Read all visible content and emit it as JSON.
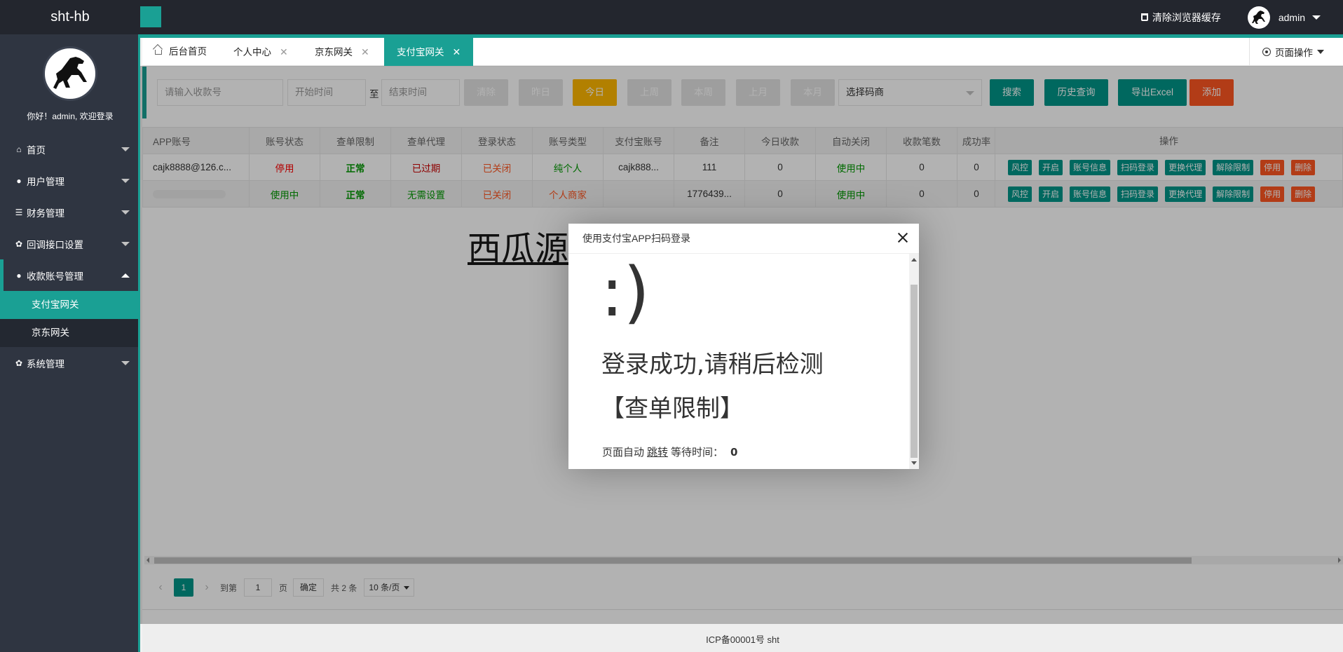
{
  "app": {
    "title": "sht-hb"
  },
  "header": {
    "clear_cache": "清除浏览器缓存",
    "user_name": "admin"
  },
  "sidebar": {
    "welcome": "你好！admin, 欢迎登录",
    "menu": [
      {
        "label": "首页",
        "icon": "home-icon"
      },
      {
        "label": "用户管理",
        "icon": "user-icon"
      },
      {
        "label": "财务管理",
        "icon": "list-icon"
      },
      {
        "label": "回调接口设置",
        "icon": "gear-icon"
      },
      {
        "label": "收款账号管理",
        "icon": "users-icon",
        "expanded": true,
        "children": [
          {
            "label": "支付宝网关",
            "active": true
          },
          {
            "label": "京东网关"
          }
        ]
      },
      {
        "label": "系统管理",
        "icon": "gear-icon"
      }
    ]
  },
  "tabs": {
    "items": [
      {
        "label": "后台首页"
      },
      {
        "label": "个人中心"
      },
      {
        "label": "京东网关"
      },
      {
        "label": "支付宝网关",
        "active": true
      }
    ],
    "close": "✕",
    "page_ops": "页面操作"
  },
  "search": {
    "account_placeholder": "请输入收款号",
    "start_placeholder": "开始时间",
    "to": "至",
    "end_placeholder": "结束时间",
    "clear": "清除",
    "yesterday": "昨日",
    "today": "今日",
    "last_week": "上周",
    "this_week": "本周",
    "last_month": "上月",
    "this_month": "本月",
    "merchant_select": "选择码商",
    "search": "搜索",
    "history": "历史查询",
    "export": "导出Excel",
    "add": "添加"
  },
  "table": {
    "columns": [
      "APP账号",
      "账号状态",
      "查单限制",
      "查单代理",
      "登录状态",
      "账号类型",
      "支付宝账号",
      "备注",
      "今日收款",
      "自动关闭",
      "收款笔数",
      "成功率"
    ],
    "ops_header": "操作",
    "rows": [
      [
        "cajk8888@126.c...",
        "停用",
        "正常",
        "已过期",
        "已关闭",
        "纯个人",
        "cajk888...",
        "111",
        "0",
        "使用中",
        "0",
        "0"
      ],
      [
        "",
        "使用中",
        "正常",
        "无需设置",
        "已关闭",
        "个人商家",
        "",
        "1776439...",
        "0",
        "使用中",
        "0",
        "0"
      ]
    ],
    "ops_buttons": [
      "风控",
      "开启",
      "账号信息",
      "扫码登录",
      "更换代理",
      "解除限制",
      "停用",
      "删除"
    ]
  },
  "pager": {
    "current": "1",
    "goto": "到第",
    "page_input": "1",
    "page_unit": "页",
    "confirm": "确定",
    "total": "共 2 条",
    "per_page": "10 条/页"
  },
  "footer": {
    "text": "ICP备00001号 sht"
  },
  "watermark": "西瓜源码",
  "modal": {
    "title": "使用支付宝APP扫码登录",
    "smile": ":)",
    "message": "登录成功,请稍后检测",
    "message2": "【查单限制】",
    "wait_prefix": "页面自动",
    "wait_link": "跳转",
    "wait_suffix": "等待时间：",
    "wait_seconds": "0"
  }
}
